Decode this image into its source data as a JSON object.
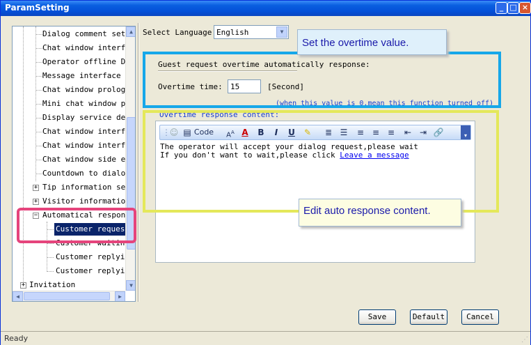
{
  "window": {
    "title": "ParamSetting"
  },
  "tree": {
    "items": [
      "Dialog comment setti",
      "Chat window interfac",
      "Operator offline Dis",
      "Message interface se",
      "Chat window prologue",
      "Mini chat window pro",
      "Display service depa",
      "Chat window interfac",
      "Chat window interfac",
      "Chat window side edg",
      "Countdown to dialog",
      "Tip information sett",
      "Visitor information",
      "Automatical response",
      "Customer requesti",
      "Customer waiting",
      "Customer replying",
      "Customer replying",
      "Invitation"
    ]
  },
  "language": {
    "label": "Select Language",
    "value": "English"
  },
  "overtime": {
    "heading": "Guest request overtime automatically response:",
    "time_label": "Overtime time:",
    "time_value": "15",
    "unit": "[Second]",
    "note": "(when this value is 0,mean this function turned off)"
  },
  "response": {
    "label": "Overtime response content:",
    "toolbar_code": "Code",
    "line1": "The operator will accept your dialog request,please wait",
    "line2_prefix": "If you don't want to wait,please click ",
    "line2_link": "Leave a message"
  },
  "callouts": {
    "overtime": "Set the overtime value.",
    "content": "Edit auto response content."
  },
  "buttons": {
    "save": "Save",
    "default": "Default",
    "cancel": "Cancel"
  },
  "status": "Ready",
  "colors": {
    "callout_blue": "#16a7e9",
    "callout_yellow": "#e4e85a",
    "callout_pink": "#e5447c",
    "titlebar": "#0450d8"
  }
}
